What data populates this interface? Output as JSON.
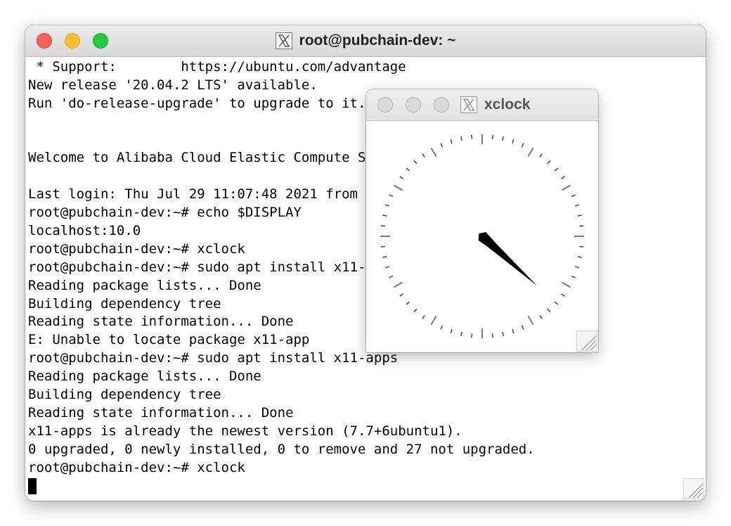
{
  "window": {
    "title": "root@pubchain-dev: ~",
    "icon": "x11-icon",
    "traffic_lights": {
      "close": "#fe5f57",
      "minimize": "#febc2e",
      "maximize": "#28c840"
    }
  },
  "terminal": {
    "lines": [
      " * Support:        https://ubuntu.com/advantage",
      "New release '20.04.2 LTS' available.",
      "Run 'do-release-upgrade' to upgrade to it.",
      "",
      "",
      "Welcome to Alibaba Cloud Elastic Compute Service !",
      "",
      "Last login: Thu Jul 29 11:07:48 2021 from",
      "root@pubchain-dev:~# echo $DISPLAY",
      "localhost:10.0",
      "root@pubchain-dev:~# xclock",
      "root@pubchain-dev:~# sudo apt install x11-app",
      "Reading package lists... Done",
      "Building dependency tree",
      "Reading state information... Done",
      "E: Unable to locate package x11-app",
      "root@pubchain-dev:~# sudo apt install x11-apps",
      "Reading package lists... Done",
      "Building dependency tree",
      "Reading state information... Done",
      "x11-apps is already the newest version (7.7+6ubuntu1).",
      "0 upgraded, 0 newly installed, 0 to remove and 27 not upgraded.",
      "root@pubchain-dev:~# xclock"
    ]
  },
  "xclock": {
    "title": "xclock",
    "icon": "x11-icon",
    "time": {
      "hour": 4,
      "minute": 22
    }
  }
}
